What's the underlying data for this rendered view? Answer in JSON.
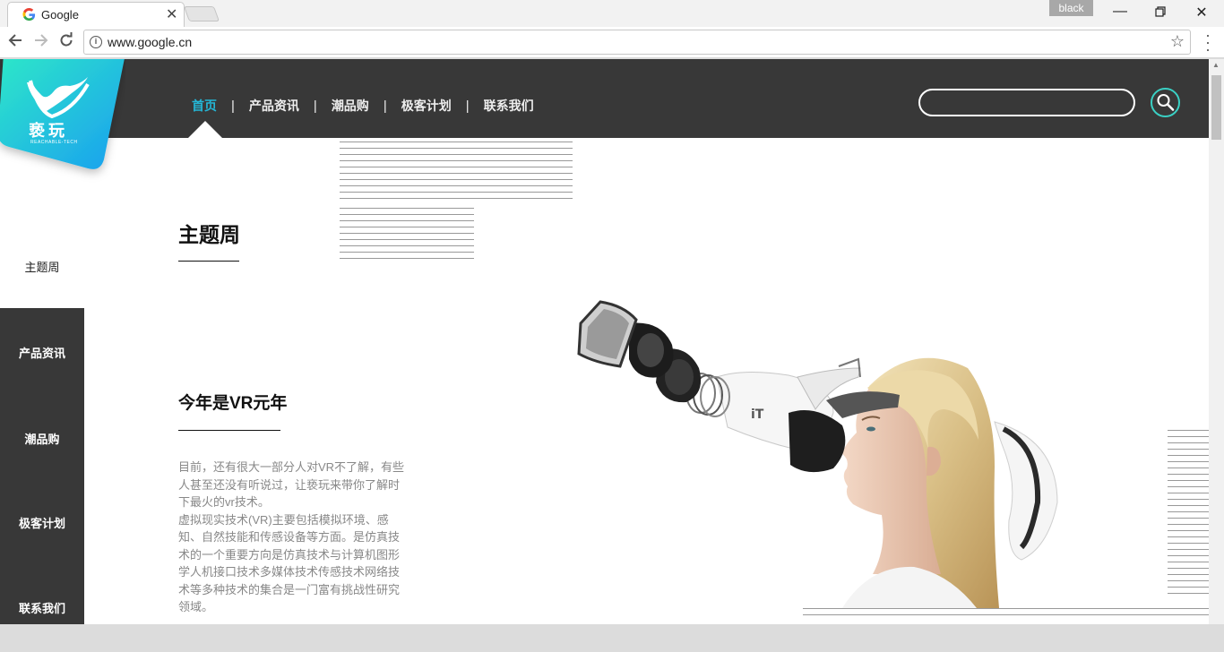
{
  "browser": {
    "tab_title": "Google",
    "tab_close": "✕",
    "profile_name": "black",
    "url": "www.google.cn"
  },
  "site": {
    "logo_text": "亵玩",
    "logo_sub": "REACHABLE-TECH",
    "nav": [
      {
        "label": "首页",
        "active": true
      },
      {
        "label": "产品资讯"
      },
      {
        "label": "潮品购"
      },
      {
        "label": "极客计划"
      },
      {
        "label": "联系我们"
      }
    ],
    "nav_separator": "|",
    "search_placeholder": "",
    "accent_color": "#24b6d6"
  },
  "sidebar": {
    "items": [
      {
        "label": "主题周"
      },
      {
        "label": "产品资讯"
      },
      {
        "label": "潮品购"
      },
      {
        "label": "极客计划"
      },
      {
        "label": "联系我们"
      }
    ]
  },
  "main": {
    "theme_title": "主题周",
    "article_title": "今年是VR元年",
    "article_paragraphs": [
      "目前，还有很大一部分人对VR不了解，有些人甚至还没有听说过，让亵玩来带你了解时下最火的vr技术。",
      "虚拟现实技术(VR)主要包括模拟环境、感知、自然技能和传感设备等方面。是仿真技术的一个重要方向是仿真技术与计算机图形学人机接口技术多媒体技术传感技术网络技术等多种技术的集合是一门富有挑战性研究领域。"
    ]
  }
}
